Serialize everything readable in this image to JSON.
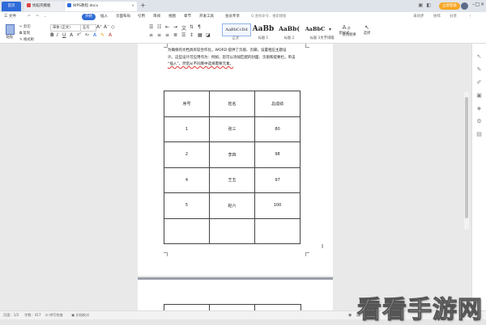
{
  "tabs": {
    "home": "首页",
    "t1": "找稻壳模板",
    "t2": "WPS教程.docx",
    "new": "+"
  },
  "window": {
    "login": "立即登录"
  },
  "menu": {
    "file": "三 文件",
    "items": [
      "开始",
      "插入",
      "页面布局",
      "引用",
      "审阅",
      "视图",
      "章节",
      "开发工具",
      "会员专享"
    ],
    "search": "Q 查找命令、搜索模板",
    "right": [
      "未同步",
      "协作",
      "分享"
    ]
  },
  "ribbon": {
    "paste": "粘贴",
    "cut": "剪切",
    "copy": "复制",
    "format": "格式刷",
    "font": "宋体 (正文)",
    "size": "五号",
    "styles": [
      {
        "sample": "AaBbCcDd",
        "label": "正文"
      },
      {
        "sample": "AaBb",
        "label": "标题 1"
      },
      {
        "sample": "AaBb(",
        "label": "标题 2"
      },
      {
        "sample": "AaBbC",
        "label": "标题 3"
      }
    ],
    "newstyle": "新样式",
    "tools": "文字排版",
    "findreplace": "查找替换",
    "select": "选择"
  },
  "doc": {
    "lines": [
      "为确保的文档具有较合作化，WORD 提供了页眉、页脚，设置相应主题设",
      "计。这些设计可应用作为：例如，您可以添加匹配的封面、页眉和提要栏。单击",
      "“插入”，然后从不同库中选择需要元素。"
    ],
    "table": {
      "header": [
        "序号",
        "姓名",
        "总成绩"
      ],
      "rows": [
        [
          "1",
          "张三",
          "80"
        ],
        [
          "2",
          "李四",
          "98"
        ],
        [
          "4",
          "王五",
          "97"
        ],
        [
          "5",
          "赵六",
          "100"
        ],
        [
          "",
          "",
          ""
        ]
      ]
    },
    "cursor": "I"
  },
  "status": {
    "page": "页面：1/2",
    "words": "字数：417",
    "spell": "拼写检查",
    "doc": "文档校对"
  },
  "watermark": "看看手游网"
}
